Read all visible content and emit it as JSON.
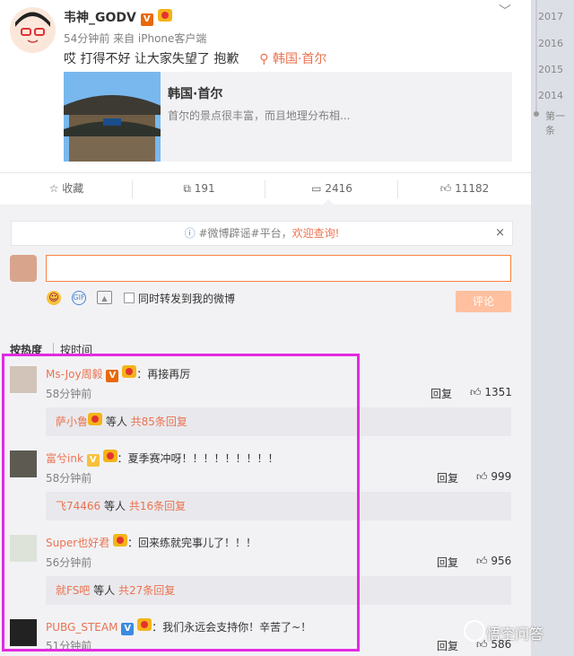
{
  "post": {
    "author": "韦神_GODV",
    "verified_badge": "V",
    "meta": "54分钟前 来自 iPhone客户端",
    "text": "哎 打得不好 让大家失望了 抱歉",
    "location": "韩国·首尔",
    "location_icon": "location-pin-icon",
    "card": {
      "title": "韩国·首尔",
      "desc": "首尔的景点很丰富，而且地理分布相..."
    }
  },
  "actions": {
    "favorite": "收藏",
    "forward_count": "191",
    "comment_count": "2416",
    "like_count": "11182"
  },
  "notice": {
    "prefix": "#微博辟谣#平台，",
    "link": "欢迎查询!",
    "close": "×"
  },
  "composer": {
    "forward_label": "同时转发到我的微博",
    "submit": "评论",
    "gif_label": "GIF"
  },
  "sort": {
    "hot": "按热度",
    "time": "按时间"
  },
  "comments": [
    {
      "name": "Ms-Joy周毅",
      "badge": "V",
      "text": "：再接再厉",
      "time": "58分钟前",
      "reply": "回复",
      "likes": "1351",
      "thread_user": "萨小鲁",
      "thread_mid": " 等人 ",
      "thread_total": "共85条回复"
    },
    {
      "name": "富兮ink",
      "badge": "V",
      "text": "：夏季赛冲呀！！！！！！！！！",
      "time": "58分钟前",
      "reply": "回复",
      "likes": "999",
      "thread_user": "飞74466",
      "thread_mid": " 等人 ",
      "thread_total": "共16条回复"
    },
    {
      "name": "Super也好君",
      "badge": "",
      "text": "：回来练就完事儿了！！！",
      "time": "56分钟前",
      "reply": "回复",
      "likes": "956",
      "thread_user": "就FS吧",
      "thread_mid": " 等人 ",
      "thread_total": "共27条回复"
    },
    {
      "name": "PUBG_STEAM",
      "badge": "V",
      "text": "：我们永远会支持你！辛苦了~！",
      "time": "51分钟前",
      "reply": "回复",
      "likes": "586"
    }
  ],
  "timeline": {
    "years": [
      "2017",
      "2016",
      "2015",
      "2014"
    ],
    "more": "第一条"
  },
  "watermark": "悟空问答",
  "colors": {
    "accent": "#eb7350",
    "highlight_border": "#e22be0",
    "verified": "#e8690a"
  }
}
